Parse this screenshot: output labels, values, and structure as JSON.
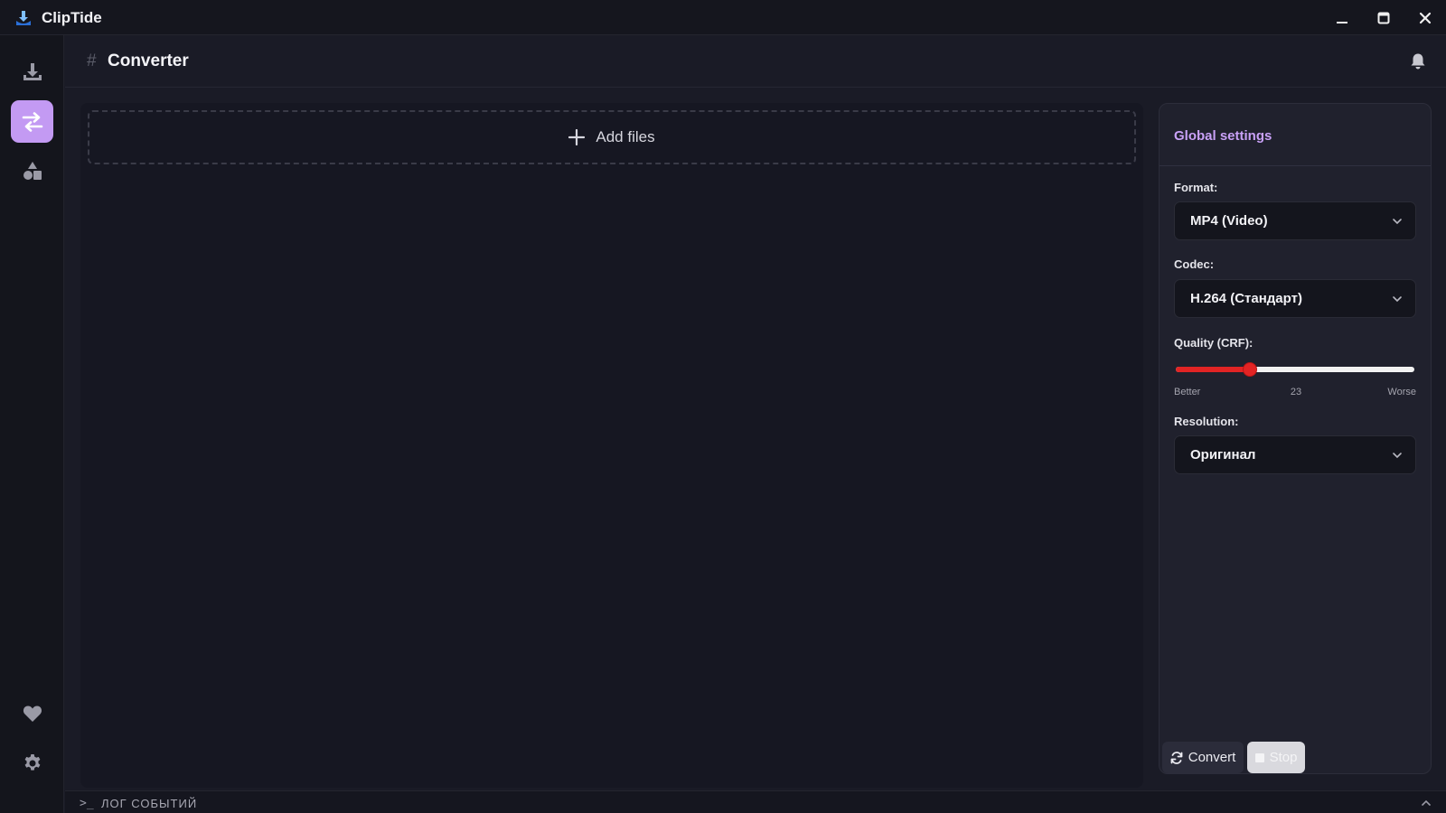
{
  "app": {
    "title": "ClipTide"
  },
  "header": {
    "hash": "#",
    "title": "Converter"
  },
  "file_area": {
    "add_files_label": "Add files"
  },
  "settings": {
    "title": "Global settings",
    "format": {
      "label": "Format:",
      "value": "MP4 (Video)"
    },
    "codec": {
      "label": "Codec:",
      "value": "H.264 (Стандарт)"
    },
    "quality": {
      "label": "Quality (CRF):",
      "value": 23,
      "value_label": "23",
      "min_label": "Better",
      "max_label": "Worse",
      "min": 0,
      "max": 77
    },
    "resolution": {
      "label": "Resolution:",
      "value": "Оригинал"
    }
  },
  "actions": {
    "convert_label": "Convert",
    "stop_label": "Stop"
  },
  "log": {
    "label": "ЛОГ СОБЫТИЙ"
  },
  "colors": {
    "accent": "#c39af3",
    "slider_fill": "#e22424",
    "title_accent": "#c9a1f7"
  },
  "icons": {
    "sidebar": [
      "download-icon",
      "convert-arrows-icon",
      "shapes-icon",
      "heart-icon",
      "gear-icon"
    ],
    "header": "bell-icon"
  }
}
